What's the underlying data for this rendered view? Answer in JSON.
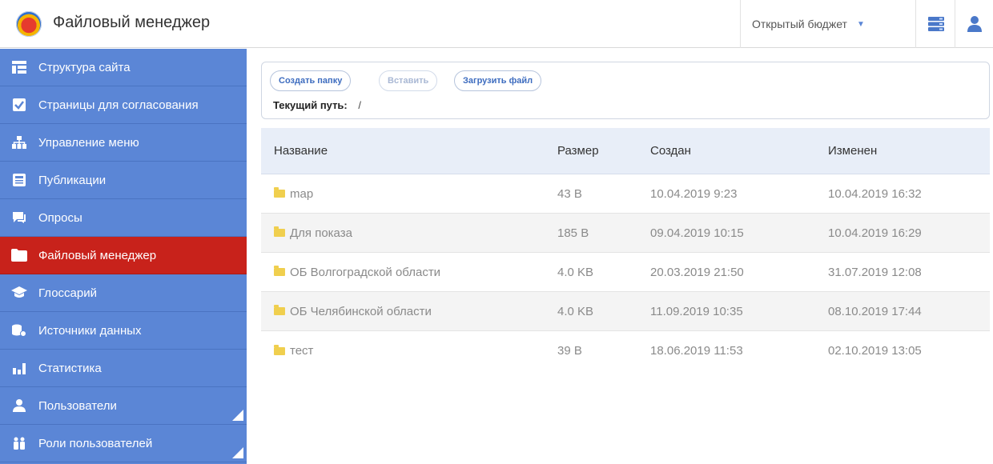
{
  "header": {
    "title": "Файловый менеджер",
    "budget_label": "Открытый бюджет"
  },
  "sidebar": {
    "items": [
      {
        "label": "Структура сайта",
        "icon": "site-structure-icon"
      },
      {
        "label": "Страницы для согласования",
        "icon": "checkbox-icon"
      },
      {
        "label": "Управление меню",
        "icon": "sitemap-icon"
      },
      {
        "label": "Публикации",
        "icon": "newspaper-icon"
      },
      {
        "label": "Опросы",
        "icon": "chat-icon"
      },
      {
        "label": "Файловый менеджер",
        "icon": "folder-icon",
        "active": true
      },
      {
        "label": "Глоссарий",
        "icon": "graduation-cap-icon"
      },
      {
        "label": "Источники данных",
        "icon": "database-icon"
      },
      {
        "label": "Статистика",
        "icon": "bar-chart-icon"
      },
      {
        "label": "Пользователи",
        "icon": "user-icon",
        "expandable": true
      },
      {
        "label": "Роли пользователей",
        "icon": "users-icon",
        "expandable": true
      }
    ]
  },
  "toolbar": {
    "create_folder": "Создать папку",
    "paste": "Вставить",
    "upload": "Загрузить файл",
    "current_path_label": "Текущий путь:",
    "current_path_value": "/"
  },
  "table": {
    "columns": [
      "Название",
      "Размер",
      "Создан",
      "Изменен"
    ],
    "rows": [
      {
        "name": "map",
        "size": "43 B",
        "created": "10.04.2019 9:23",
        "modified": "10.04.2019 16:32"
      },
      {
        "name": "Для показа",
        "size": "185 B",
        "created": "09.04.2019 10:15",
        "modified": "10.04.2019 16:29"
      },
      {
        "name": "ОБ Волгоградской области",
        "size": "4.0 KB",
        "created": "20.03.2019 21:50",
        "modified": "31.07.2019 12:08"
      },
      {
        "name": "ОБ Челябинской области",
        "size": "4.0 KB",
        "created": "11.09.2019 10:35",
        "modified": "08.10.2019 17:44"
      },
      {
        "name": "тест",
        "size": "39 B",
        "created": "18.06.2019 11:53",
        "modified": "02.10.2019 13:05"
      }
    ]
  },
  "colors": {
    "sidebar_bg": "#5b86d6",
    "active_item": "#c8221b",
    "folder": "#f0cf4e",
    "table_header_bg": "#e8eef8"
  }
}
